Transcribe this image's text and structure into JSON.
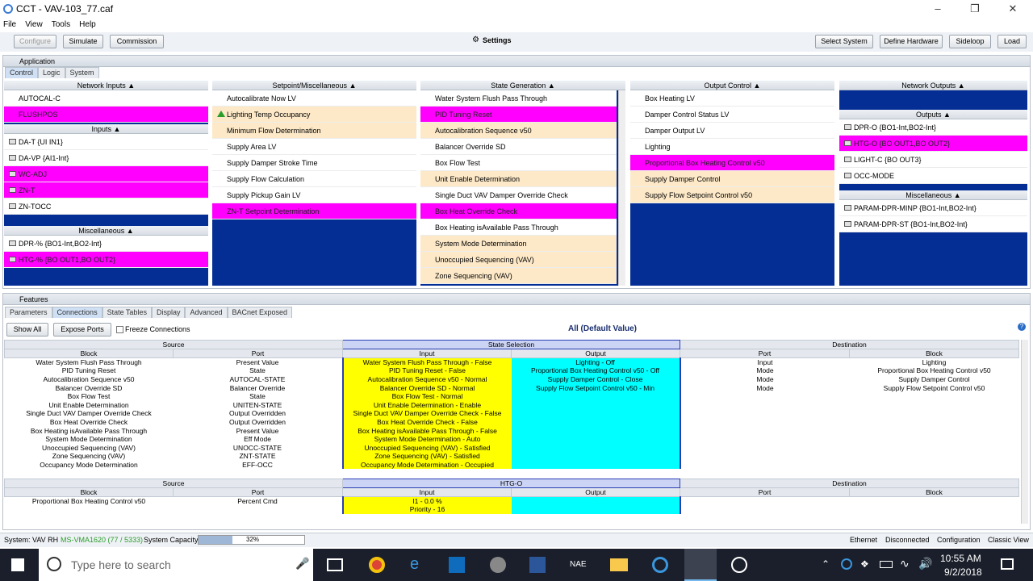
{
  "window": {
    "title": "CCT - VAV-103_77.caf"
  },
  "menu": [
    "File",
    "View",
    "Tools",
    "Help"
  ],
  "toolbar": {
    "configure": "Configure",
    "simulate": "Simulate",
    "commission": "Commission",
    "settings": "Settings",
    "select_system": "Select System",
    "define_hardware": "Define Hardware",
    "sideloop": "Sideloop",
    "load": "Load"
  },
  "application": {
    "title": "Application",
    "tabs": [
      "Control",
      "Logic",
      "System"
    ]
  },
  "network_inputs": {
    "header": "Network Inputs",
    "rows": [
      "AUTOCAL-C",
      "FLUSHPOS"
    ]
  },
  "inputs": {
    "header": "Inputs",
    "rows": [
      "DA-T {UI IN1}",
      "DA-VP {AI1-Int}",
      "WC-ADJ",
      "ZN-T",
      "ZN-TOCC"
    ]
  },
  "misc_left": {
    "header": "Miscellaneous",
    "rows": [
      "DPR-% {BO1-Int,BO2-Int}",
      "HTG-% {BO OUT1,BO OUT2}"
    ]
  },
  "setpoint": {
    "header": "Setpoint/Miscellaneous",
    "rows": [
      "Autocalibrate Now LV",
      "Lighting Temp Occupancy",
      "Minimum Flow Determination",
      "Supply Area LV",
      "Supply Damper Stroke Time",
      "Supply Flow Calculation",
      "Supply Pickup Gain LV",
      "ZN-T Setpoint Determination"
    ]
  },
  "state_gen": {
    "header": "State Generation",
    "rows": [
      "Water System Flush Pass Through",
      "PID Tuning Reset",
      "Autocalibration Sequence v50",
      "Balancer Override SD",
      "Box Flow Test",
      "Unit Enable Determination",
      "Single Duct VAV Damper Override Check",
      "Box Heat Override Check",
      "Box Heating isAvailable Pass Through",
      "System Mode Determination",
      "Unoccupied Sequencing (VAV)",
      "Zone Sequencing (VAV)"
    ]
  },
  "output_control": {
    "header": "Output Control",
    "rows": [
      "Box Heating LV",
      "Damper Control Status LV",
      "Damper Output LV",
      "Lighting",
      "Proportional Box Heating Control v50",
      "Supply Damper Control",
      "Supply Flow Setpoint Control v50"
    ]
  },
  "network_outputs": {
    "header": "Network Outputs"
  },
  "outputs": {
    "header": "Outputs",
    "rows": [
      "DPR-O {BO1-Int,BO2-Int}",
      "HTG-O {BO OUT1,BO OUT2}",
      "LIGHT-C {BO OUT3}",
      "OCC-MODE"
    ]
  },
  "misc_right": {
    "header": "Miscellaneous",
    "rows": [
      "PARAM-DPR-MINP {BO1-Int,BO2-Int}",
      "PARAM-DPR-ST {BO1-Int,BO2-Int}"
    ]
  },
  "features": {
    "title": "Features",
    "tabs": [
      "Parameters",
      "Connections",
      "State Tables",
      "Display",
      "Advanced",
      "BACnet Exposed"
    ],
    "show_all": "Show All",
    "expose_ports": "Expose Ports",
    "freeze": "Freeze Connections",
    "view_title": "All (Default Value)"
  },
  "table1": {
    "source": "Source",
    "selection": "State Selection",
    "destination": "Destination",
    "block": "Block",
    "port": "Port",
    "input": "Input",
    "output": "Output",
    "rows": [
      [
        "Water System Flush Pass Through",
        "Present Value",
        "Water System Flush Pass Through - False",
        "Lighting - Off",
        "Input",
        "Lighting"
      ],
      [
        "PID Tuning Reset",
        "State",
        "PID Tuning Reset - False",
        "Proportional Box Heating Control v50 - Off",
        "Mode",
        "Proportional Box Heating Control v50"
      ],
      [
        "Autocalibration Sequence v50",
        "AUTOCAL-STATE",
        "Autocalibration Sequence v50 - Normal",
        "Supply Damper Control - Close",
        "Mode",
        "Supply Damper Control"
      ],
      [
        "Balancer Override SD",
        "Balancer Override",
        "Balancer Override SD - Normal",
        "Supply Flow Setpoint Control v50 - Min",
        "Mode",
        "Supply Flow Setpoint Control v50"
      ],
      [
        "Box Flow Test",
        "State",
        "Box Flow Test - Normal",
        "",
        "",
        ""
      ],
      [
        "Unit Enable Determination",
        "UNITEN-STATE",
        "Unit Enable Determination - Enable",
        "",
        "",
        ""
      ],
      [
        "Single Duct VAV Damper Override Check",
        "Output Overridden",
        "Single Duct VAV Damper Override Check - False",
        "",
        "",
        ""
      ],
      [
        "Box Heat Override Check",
        "Output Overridden",
        "Box Heat Override Check - False",
        "",
        "",
        ""
      ],
      [
        "Box Heating isAvailable Pass Through",
        "Present Value",
        "Box Heating isAvailable Pass Through - False",
        "",
        "",
        ""
      ],
      [
        "System Mode Determination",
        "Eff Mode",
        "System Mode Determination - Auto",
        "",
        "",
        ""
      ],
      [
        "Unoccupied Sequencing (VAV)",
        "UNOCC-STATE",
        "Unoccupied Sequencing (VAV) - Satisfied",
        "",
        "",
        ""
      ],
      [
        "Zone Sequencing (VAV)",
        "ZNT-STATE",
        "Zone Sequencing (VAV) - Satisfied",
        "",
        "",
        ""
      ],
      [
        "Occupancy Mode Determination",
        "EFF-OCC",
        "Occupancy Mode Determination - Occupied",
        "",
        "",
        ""
      ]
    ]
  },
  "table2": {
    "source": "Source",
    "selection": "HTG-O",
    "destination": "Destination",
    "block": "Block",
    "port": "Port",
    "input": "Input",
    "output": "Output",
    "rows": [
      [
        "Proportional Box Heating Control v50",
        "Percent Cmd",
        "I1 - 0.0 %",
        "",
        "",
        ""
      ],
      [
        "",
        "",
        "Priority - 16",
        "",
        "",
        ""
      ]
    ]
  },
  "status": {
    "system": "System: VAV RH",
    "controller": "MS-VMA1620 (77 / 5333)",
    "capacity_label": "System Capacity",
    "capacity": "32%",
    "capacity_fraction": 0.32,
    "ethernet": "Ethernet",
    "disconnected": "Disconnected",
    "configuration": "Configuration",
    "classic": "Classic View"
  },
  "taskbar": {
    "search": "Type here to search",
    "time": "10:55 AM",
    "date": "9/2/2018"
  }
}
